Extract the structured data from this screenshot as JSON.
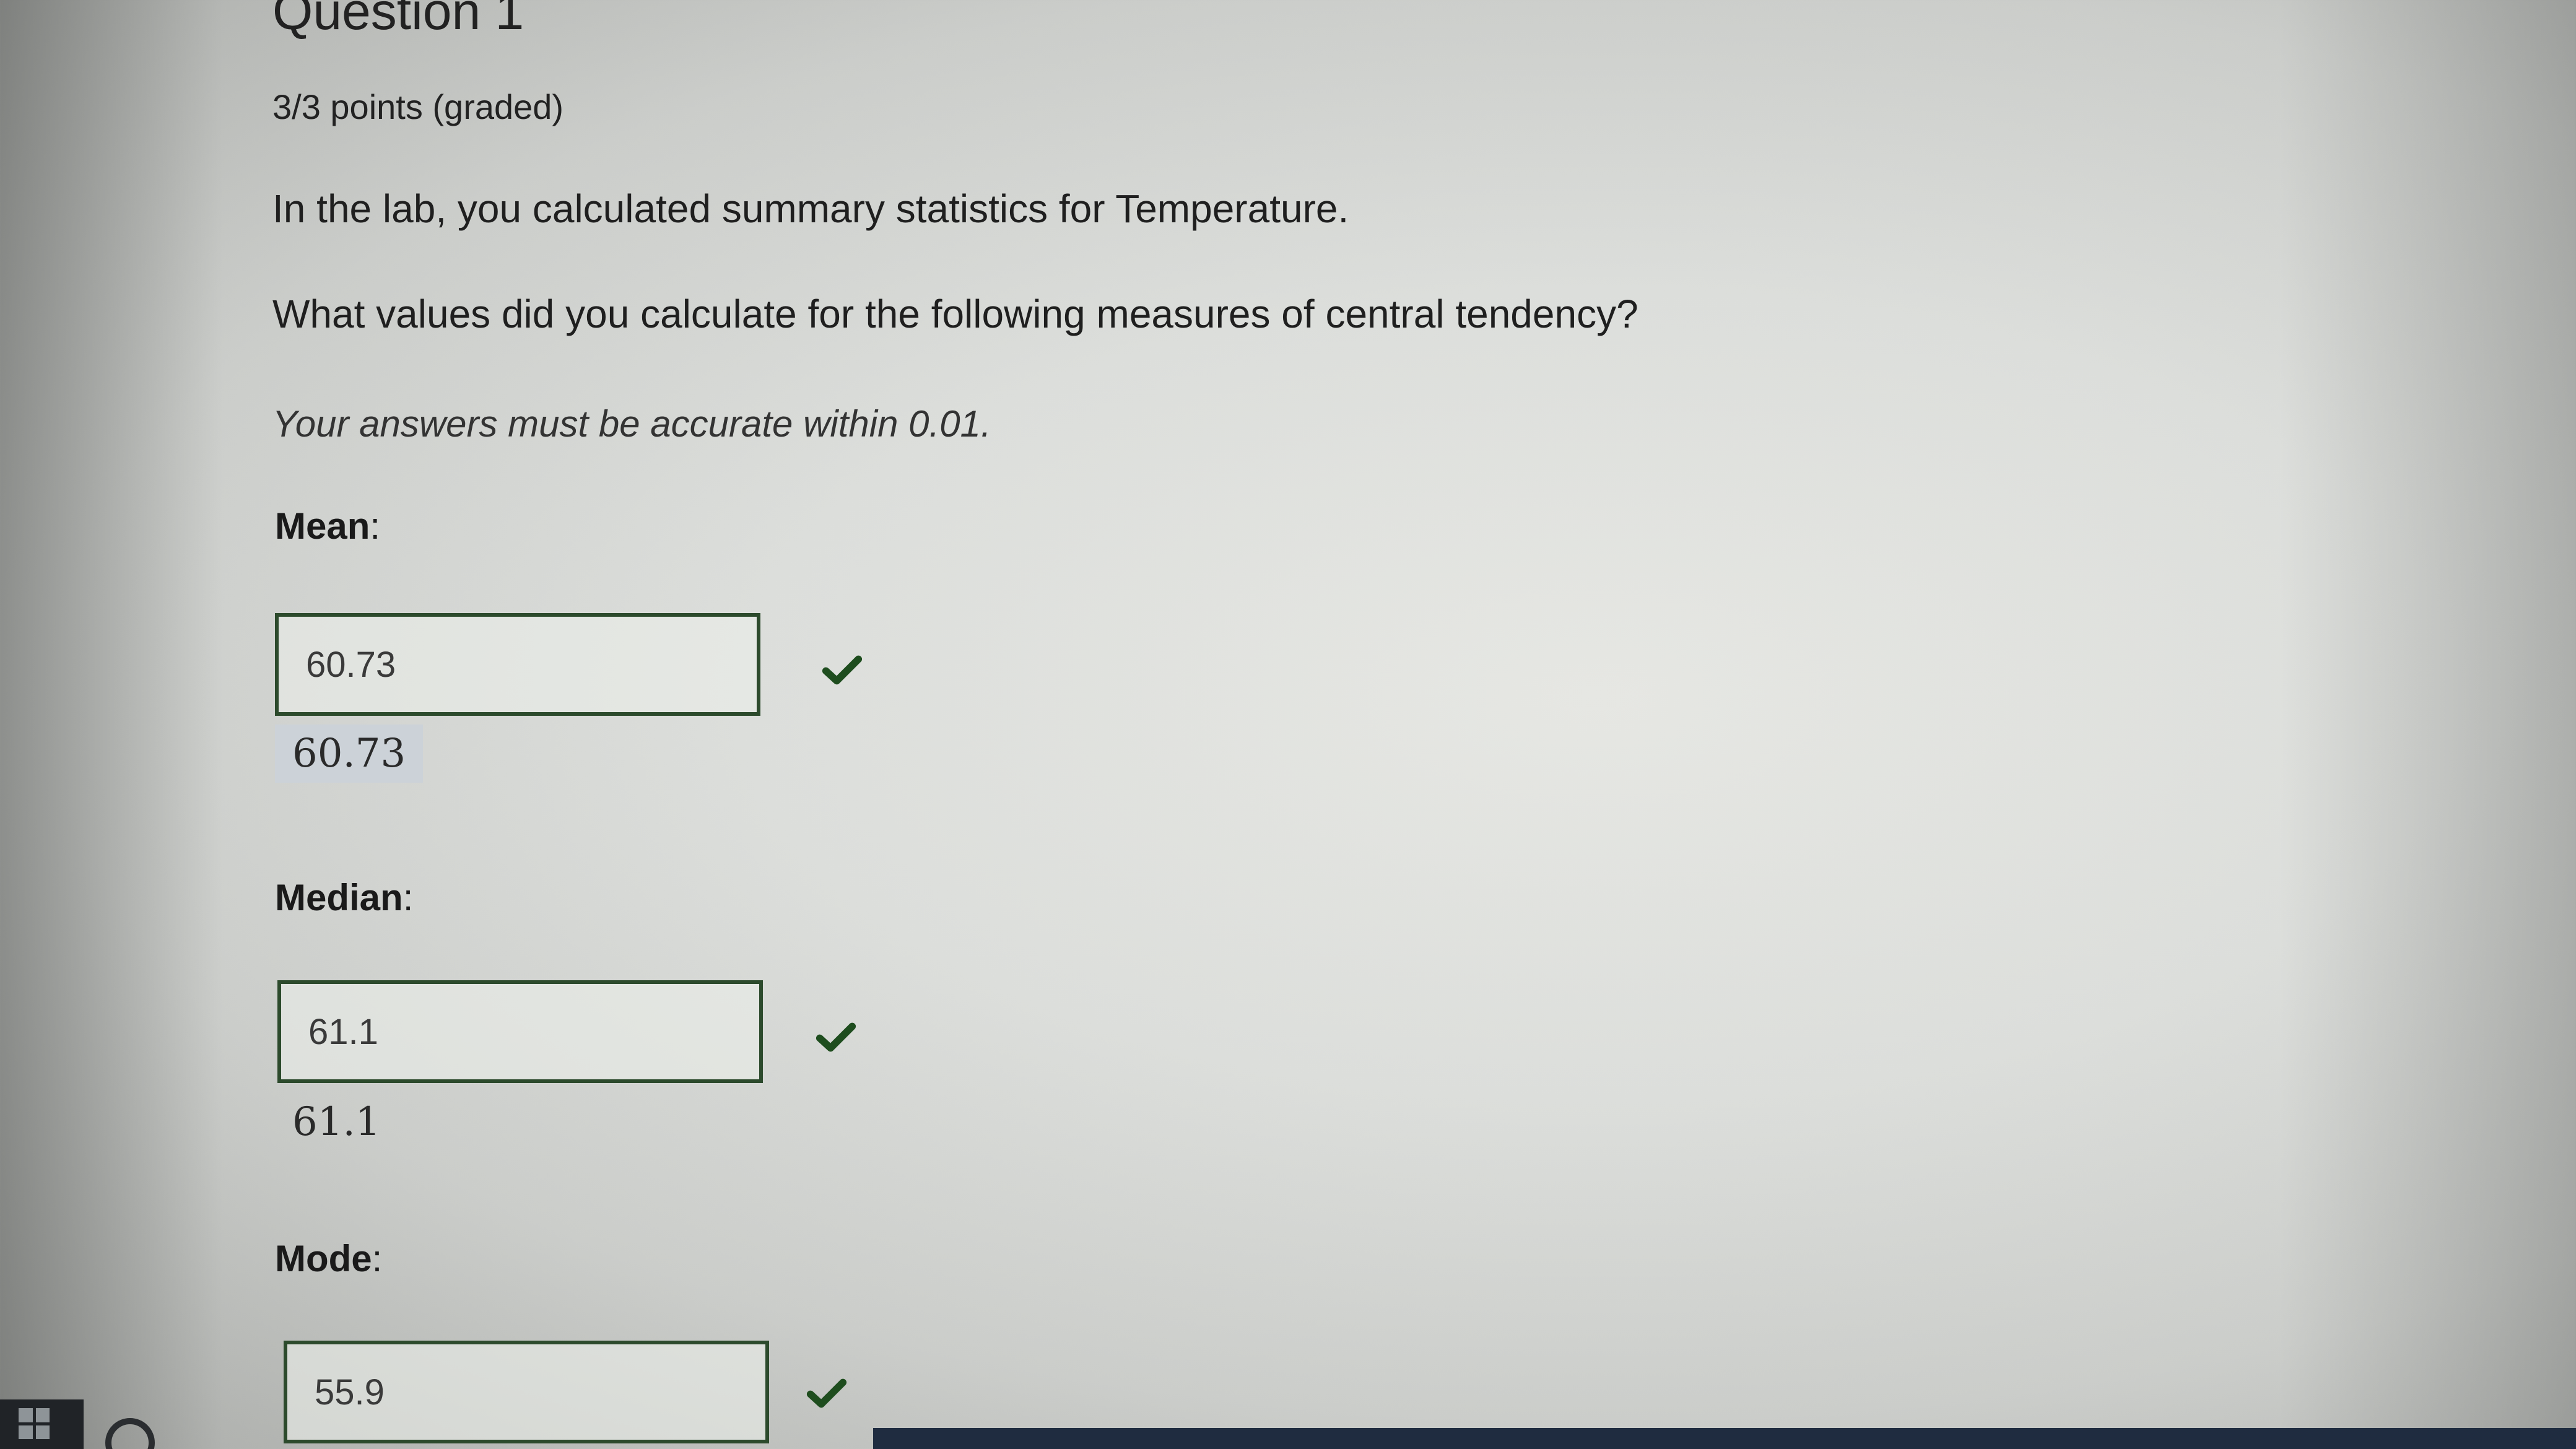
{
  "question": {
    "title": "Question 1",
    "points": "3/3 points (graded)",
    "prompt_line1": "In the lab, you calculated summary statistics for Temperature.",
    "prompt_line2": "What values did you calculate for the following measures of central tendency?",
    "instruction": "Your answers must be accurate within 0.01."
  },
  "fields": [
    {
      "label": "Mean",
      "colon": ":",
      "value": "60.73",
      "echo": "60.73",
      "status": "correct"
    },
    {
      "label": "Median",
      "colon": ":",
      "value": "61.1",
      "echo": "61.1",
      "status": "correct"
    },
    {
      "label": "Mode",
      "colon": ":",
      "value": "55.9",
      "status": "correct"
    }
  ],
  "icons": {
    "correct": "checkmark-icon",
    "taskbar_start": "windows-start-icon",
    "taskbar_search": "search-icon"
  },
  "colors": {
    "correct_check": "#1e4d1e",
    "input_border": "#2c4a2c",
    "echo_highlight": "#ccd2d8"
  }
}
